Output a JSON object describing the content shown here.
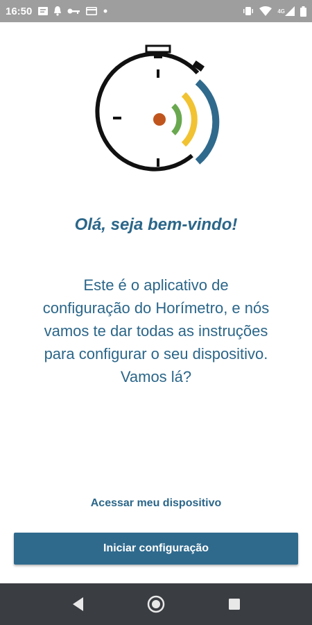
{
  "status_bar": {
    "time": "16:50",
    "network_label": "4G",
    "left_icons": [
      "message-icon",
      "notification-icon",
      "key-icon",
      "card-icon",
      "dot-icon"
    ],
    "right_icons": [
      "vibrate-icon",
      "wifi-icon",
      "cell-signal-icon",
      "battery-icon"
    ]
  },
  "welcome": {
    "title": "Olá, seja bem-vindo!",
    "lines": [
      "Este é o aplicativo de",
      "configuração do Horímetro, e nós",
      "vamos te dar todas as instruções",
      "para configurar o seu dispositivo.",
      "Vamos lá?"
    ]
  },
  "actions": {
    "access_label": "Acessar meu dispositivo",
    "start_label": "Iniciar configuração"
  },
  "nav_bar": {
    "icons": [
      "back-icon",
      "home-icon",
      "recent-apps-icon"
    ]
  },
  "colors": {
    "primary": "#2f6a8d",
    "text": "#2b6689",
    "status_bar": "#9e9e9e",
    "nav_bar": "#3a3d42",
    "center_dot": "#c0561e",
    "wave_green": "#6aa84f",
    "wave_yellow": "#f1c232",
    "wave_blue": "#2f6a8d"
  }
}
